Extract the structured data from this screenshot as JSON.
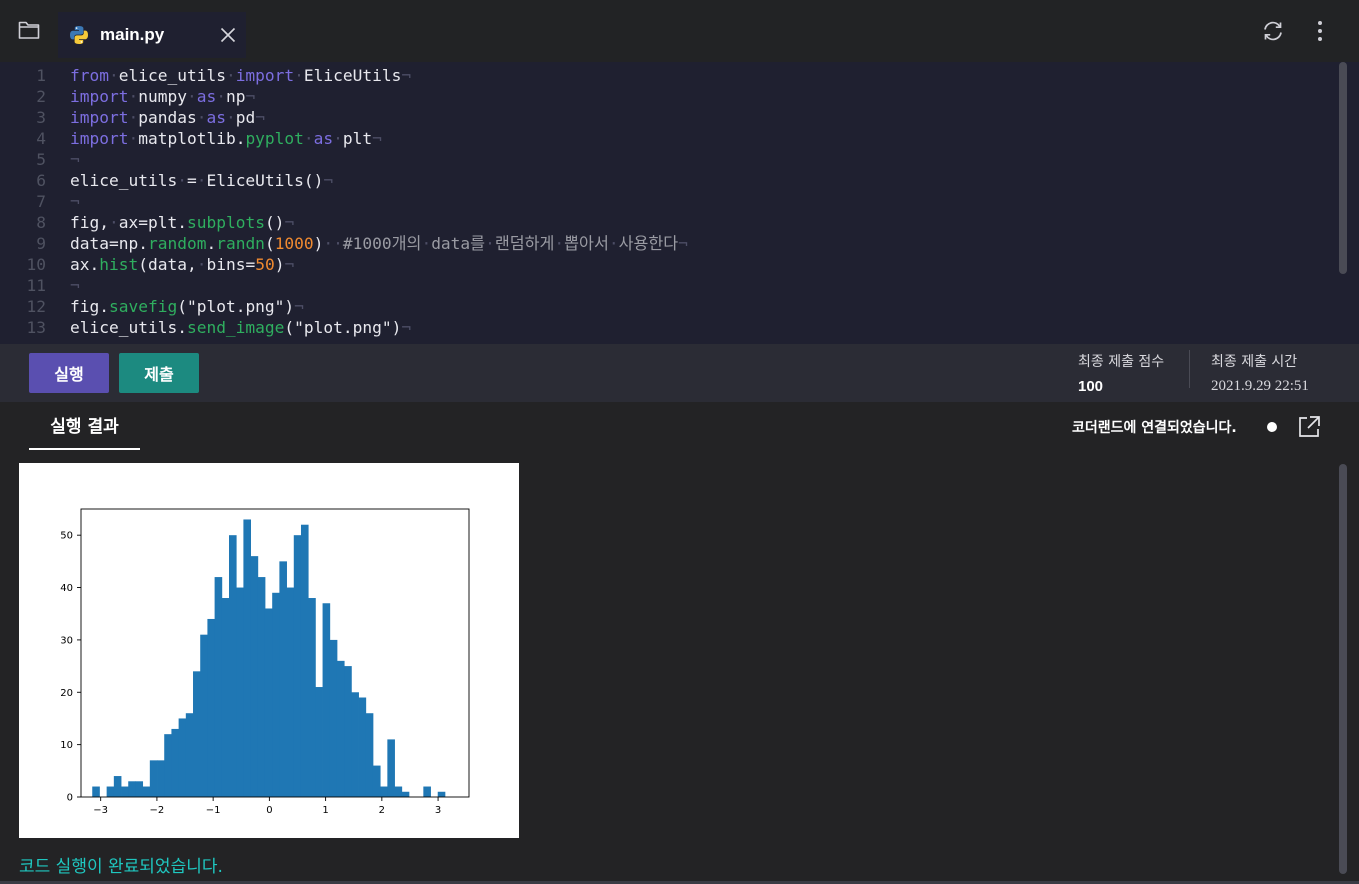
{
  "tab": {
    "filename": "main.py"
  },
  "editor": {
    "lines": [
      [
        [
          "kw",
          "from"
        ],
        [
          "ws",
          "·"
        ],
        [
          "t",
          "elice_utils"
        ],
        [
          "ws",
          "·"
        ],
        [
          "kw",
          "import"
        ],
        [
          "ws",
          "·"
        ],
        [
          "t",
          "EliceUtils"
        ],
        [
          "ws",
          "¬"
        ]
      ],
      [
        [
          "kw",
          "import"
        ],
        [
          "ws",
          "·"
        ],
        [
          "t",
          "numpy"
        ],
        [
          "ws",
          "·"
        ],
        [
          "kw",
          "as"
        ],
        [
          "ws",
          "·"
        ],
        [
          "t",
          "np"
        ],
        [
          "ws",
          "¬"
        ]
      ],
      [
        [
          "kw",
          "import"
        ],
        [
          "ws",
          "·"
        ],
        [
          "t",
          "pandas"
        ],
        [
          "ws",
          "·"
        ],
        [
          "kw",
          "as"
        ],
        [
          "ws",
          "·"
        ],
        [
          "t",
          "pd"
        ],
        [
          "ws",
          "¬"
        ]
      ],
      [
        [
          "kw",
          "import"
        ],
        [
          "ws",
          "·"
        ],
        [
          "t",
          "matplotlib."
        ],
        [
          "fn",
          "pyplot"
        ],
        [
          "ws",
          "·"
        ],
        [
          "kw",
          "as"
        ],
        [
          "ws",
          "·"
        ],
        [
          "t",
          "plt"
        ],
        [
          "ws",
          "¬"
        ]
      ],
      [
        [
          "ws",
          "¬"
        ]
      ],
      [
        [
          "t",
          "elice_utils"
        ],
        [
          "ws",
          "·"
        ],
        [
          "t",
          "="
        ],
        [
          "ws",
          "·"
        ],
        [
          "t",
          "EliceUtils()"
        ],
        [
          "ws",
          "¬"
        ]
      ],
      [
        [
          "ws",
          "¬"
        ]
      ],
      [
        [
          "t",
          "fig,"
        ],
        [
          "ws",
          "·"
        ],
        [
          "t",
          "ax=plt."
        ],
        [
          "fn",
          "subplots"
        ],
        [
          "t",
          "()"
        ],
        [
          "ws",
          "¬"
        ]
      ],
      [
        [
          "t",
          "data=np."
        ],
        [
          "fn",
          "random"
        ],
        [
          "t",
          "."
        ],
        [
          "fn",
          "randn"
        ],
        [
          "t",
          "("
        ],
        [
          "num",
          "1000"
        ],
        [
          "t",
          ")"
        ],
        [
          "ws",
          "··"
        ],
        [
          "cm",
          "#1000개의"
        ],
        [
          "ws",
          "·"
        ],
        [
          "cm",
          "data를"
        ],
        [
          "ws",
          "·"
        ],
        [
          "cm",
          "랜덤하게"
        ],
        [
          "ws",
          "·"
        ],
        [
          "cm",
          "뽑아서"
        ],
        [
          "ws",
          "·"
        ],
        [
          "cm",
          "사용한다"
        ],
        [
          "ws",
          "¬"
        ]
      ],
      [
        [
          "t",
          "ax."
        ],
        [
          "fn",
          "hist"
        ],
        [
          "t",
          "(data,"
        ],
        [
          "ws",
          "·"
        ],
        [
          "t",
          "bins="
        ],
        [
          "num",
          "50"
        ],
        [
          "t",
          ")"
        ],
        [
          "ws",
          "¬"
        ]
      ],
      [
        [
          "ws",
          "¬"
        ]
      ],
      [
        [
          "t",
          "fig."
        ],
        [
          "fn",
          "savefig"
        ],
        [
          "t",
          "(\"plot.png\")"
        ],
        [
          "ws",
          "¬"
        ]
      ],
      [
        [
          "t",
          "elice_utils."
        ],
        [
          "fn",
          "send_image"
        ],
        [
          "t",
          "(\"plot.png\")"
        ],
        [
          "ws",
          "¬"
        ]
      ]
    ]
  },
  "actions": {
    "run_label": "실행",
    "submit_label": "제출"
  },
  "submission": {
    "score_label": "최종 제출 점수",
    "score_value": "100",
    "time_label": "최종 제출 시간",
    "time_value": "2021.9.29 22:51"
  },
  "output": {
    "tab_label": "실행 결과",
    "connection_status": "코더랜드에 연결되었습니다.",
    "completion_message": "코드 실행이 완료되었습니다."
  },
  "colors": {
    "bar": "#1f77b4",
    "run_button": "#5a4fb0",
    "submit_button": "#1c8a80",
    "success_text": "#1fc7c0"
  },
  "chart_data": {
    "type": "bar",
    "title": "",
    "xlabel": "",
    "ylabel": "",
    "xlim": [
      -3.35,
      3.55
    ],
    "ylim": [
      0,
      55
    ],
    "xticks": [
      -3,
      -2,
      -1,
      0,
      1,
      2,
      3
    ],
    "yticks": [
      0,
      10,
      20,
      30,
      40,
      50
    ],
    "bins": {
      "start": -3.15,
      "width": 0.128
    },
    "values": [
      2,
      0,
      2,
      4,
      2,
      3,
      3,
      2,
      7,
      7,
      12,
      13,
      15,
      16,
      24,
      31,
      34,
      42,
      38,
      50,
      40,
      53,
      46,
      42,
      36,
      39,
      45,
      40,
      50,
      52,
      38,
      21,
      37,
      30,
      26,
      25,
      20,
      19,
      16,
      6,
      2,
      11,
      2,
      1,
      0,
      0,
      2,
      0,
      1,
      0
    ]
  }
}
